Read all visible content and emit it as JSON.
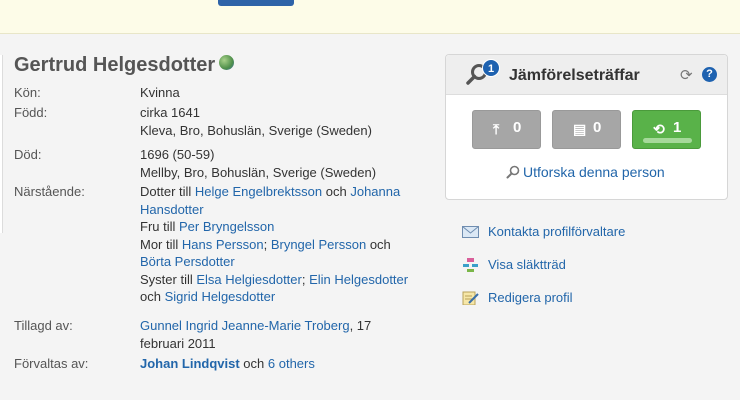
{
  "person": {
    "name": "Gertrud Helgesdotter"
  },
  "facts": {
    "gender": {
      "label": "Kön:",
      "value": "Kvinna"
    },
    "born": {
      "label": "Född:",
      "date": "cirka 1641",
      "place": "Kleva, Bro, Bohuslän, Sverige (Sweden)"
    },
    "died": {
      "label": "Död:",
      "date": "1696 (50-59)",
      "place": "Mellby, Bro, Bohuslän, Sverige (Sweden)"
    },
    "relatives": {
      "label": "Närstående:",
      "daughter_prefix": "Dotter till",
      "father": "Helge Engelbrektsson",
      "and1": "och",
      "mother_line1": "Johanna",
      "mother_line2": "Hansdotter",
      "wife_prefix": "Fru till",
      "husband": "Per Bryngelsson",
      "mother_prefix": "Mor till",
      "child1": "Hans Persson",
      "sep1": ";",
      "child2": "Bryngel Persson",
      "and2": "och",
      "child3": "Börta Persdotter",
      "sister_prefix": "Syster till",
      "sibling1": "Elsa Helgiesdotter",
      "sep2": ";",
      "sibling2": "Elin Helgesdotter",
      "and3": "och",
      "sibling3": "Sigrid Helgesdotter"
    },
    "added_by": {
      "label": "Tillagd av:",
      "user": "Gunnel Ingrid Jeanne-Marie Troberg",
      "date_part1": ", 17",
      "date_part2": "februari 2011"
    },
    "managed_by": {
      "label": "Förvaltas av:",
      "manager": "Johan Lindqvist",
      "and": "och",
      "others": "6 others"
    }
  },
  "matches": {
    "title": "Jämförelseträffar",
    "badge_count": "1",
    "refresh_icon": "refresh-icon",
    "help_label": "?",
    "buttons": [
      {
        "icon": "tree-icon",
        "count": "0"
      },
      {
        "icon": "document-icon",
        "count": "0"
      },
      {
        "icon": "sync-icon",
        "count": "1"
      }
    ],
    "explore_label": "Utforska denna person"
  },
  "actions": {
    "contact": "Kontakta profilförvaltare",
    "tree": "Visa släktträd",
    "edit": "Redigera profil"
  },
  "colors": {
    "link": "#2266aa",
    "badge": "#1e62b0",
    "green_button": "#59b249",
    "gray_button": "#a6a6a6"
  }
}
